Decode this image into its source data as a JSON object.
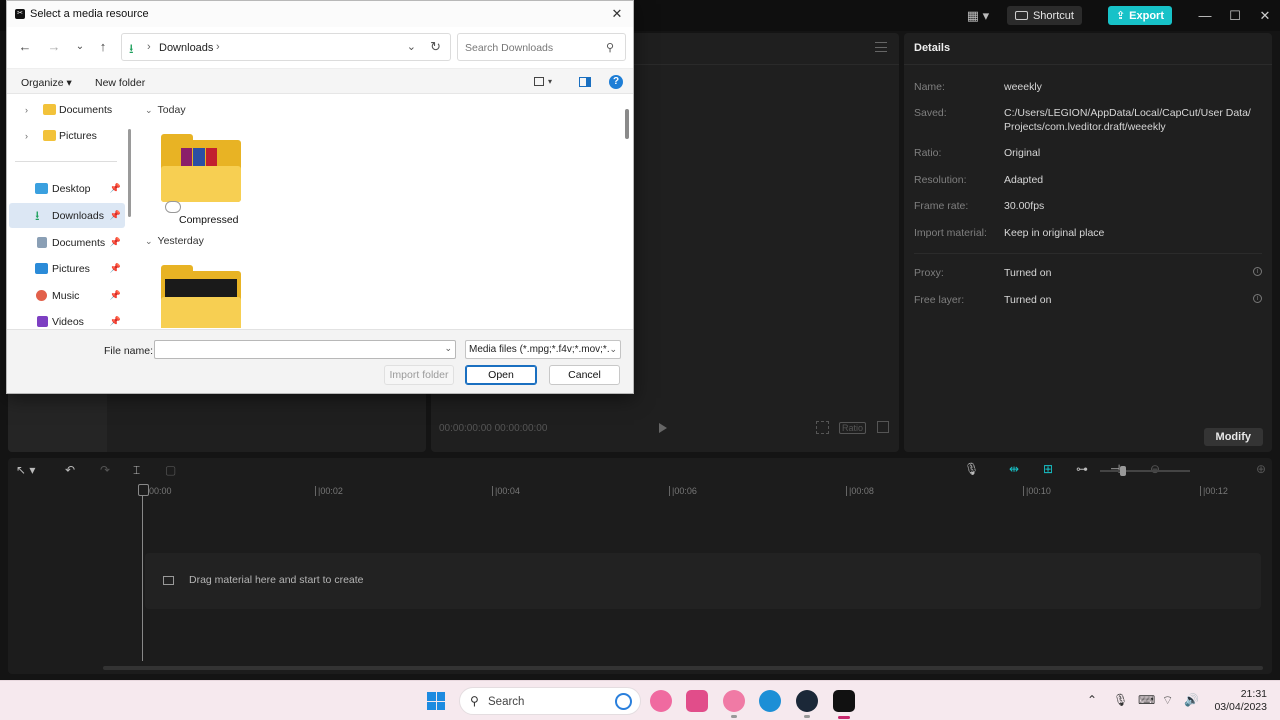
{
  "app": {
    "shortcut_label": "Shortcut",
    "export_label": "Export",
    "win_controls": [
      "—",
      "☐",
      "✕"
    ]
  },
  "player": {
    "timecode": "00:00:00:00  00:00:00:00",
    "ratio_label": "Ratio"
  },
  "details": {
    "title": "Details",
    "rows": [
      {
        "label": "Name:",
        "value": "weeekly"
      },
      {
        "label": "Saved:",
        "value": "C:/Users/LEGION/AppData/Local/CapCut/User Data/\nProjects/com.lveditor.draft/weeekly"
      },
      {
        "label": "Ratio:",
        "value": "Original"
      },
      {
        "label": "Resolution:",
        "value": "Adapted"
      },
      {
        "label": "Frame rate:",
        "value": "30.00fps"
      },
      {
        "label": "Import material:",
        "value": "Keep in original place"
      },
      {
        "label": "Proxy:",
        "value": "Turned on"
      },
      {
        "label": "Free layer:",
        "value": "Turned on"
      }
    ],
    "modify_label": "Modify"
  },
  "timeline": {
    "ticks": [
      "00:00",
      "|00:02",
      "|00:04",
      "|00:06",
      "|00:08",
      "|00:10",
      "|00:12"
    ],
    "track_hint": "Drag material here and start to create"
  },
  "dialog": {
    "title": "Select a media resource",
    "address": "Downloads",
    "search_placeholder": "Search Downloads",
    "organize_label": "Organize ▾",
    "new_folder_label": "New folder",
    "help_label": "?",
    "sidebar": {
      "tree": [
        {
          "label": "Documents",
          "icon": "folder-icon"
        },
        {
          "label": "Pictures",
          "icon": "folder-icon"
        }
      ],
      "quick": [
        {
          "label": "Desktop",
          "icon": "desktop-icon"
        },
        {
          "label": "Downloads",
          "icon": "download-icon",
          "selected": true
        },
        {
          "label": "Documents",
          "icon": "document-icon"
        },
        {
          "label": "Pictures",
          "icon": "pictures-icon"
        },
        {
          "label": "Music",
          "icon": "music-icon"
        },
        {
          "label": "Videos",
          "icon": "videos-icon"
        }
      ]
    },
    "groups": [
      {
        "header": "Today",
        "items": [
          {
            "label": "Compressed"
          }
        ]
      },
      {
        "header": "Yesterday",
        "items": [
          {
            "label": ""
          }
        ]
      }
    ],
    "file_name_label": "File name:",
    "file_name_value": "",
    "filter_value": "Media files (*.mpg;*.f4v;*.mov;*.",
    "import_folder_label": "Import folder",
    "open_label": "Open",
    "cancel_label": "Cancel"
  },
  "taskbar": {
    "search_label": "Search",
    "time": "21:31",
    "date": "03/04/2023"
  },
  "colors": {
    "accent": "#17c2c8",
    "dialog_selection": "#dce7f4",
    "taskbar_bg": "#f6e9ee"
  }
}
